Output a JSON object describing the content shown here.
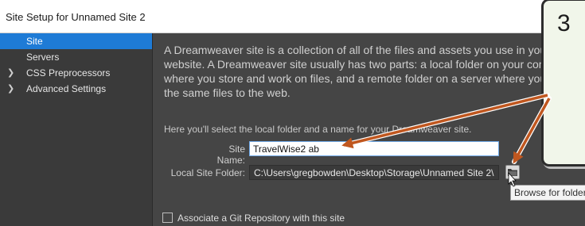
{
  "window": {
    "title": "Site Setup for Unnamed Site 2"
  },
  "sidebar": {
    "items": [
      {
        "label": "Site",
        "active": true,
        "expandable": false
      },
      {
        "label": "Servers",
        "active": false,
        "expandable": false
      },
      {
        "label": "CSS Preprocessors",
        "active": false,
        "expandable": true
      },
      {
        "label": "Advanced Settings",
        "active": false,
        "expandable": true
      }
    ]
  },
  "site_panel": {
    "intro": "A Dreamweaver site is a collection of all of the files and assets you use in your\nwebsite. A Dreamweaver site usually has two parts: a local folder on your computer\nwhere you store and work on files, and a remote folder on a server where you post\nthe same files to the web.",
    "local_hint": "Here you'll select the local folder and a name for your Dreamweaver site.",
    "site_name_label": "Site Name:",
    "site_name_value": "TravelWise2 ab",
    "local_folder_label": "Local Site Folder:",
    "local_folder_value": "C:\\Users\\gregbowden\\Desktop\\Storage\\Unnamed Site 2\\",
    "git_label": "Associate a Git Repository with this site"
  },
  "tooltip": {
    "text": "Browse for folder"
  },
  "callout": {
    "number": "3"
  },
  "colors": {
    "accent": "#1e7bd6",
    "arrow": "#c0571f",
    "panel_bg": "#454545",
    "sidebar_bg": "#3a3a3a",
    "callout_bg": "#f1f6ea"
  }
}
